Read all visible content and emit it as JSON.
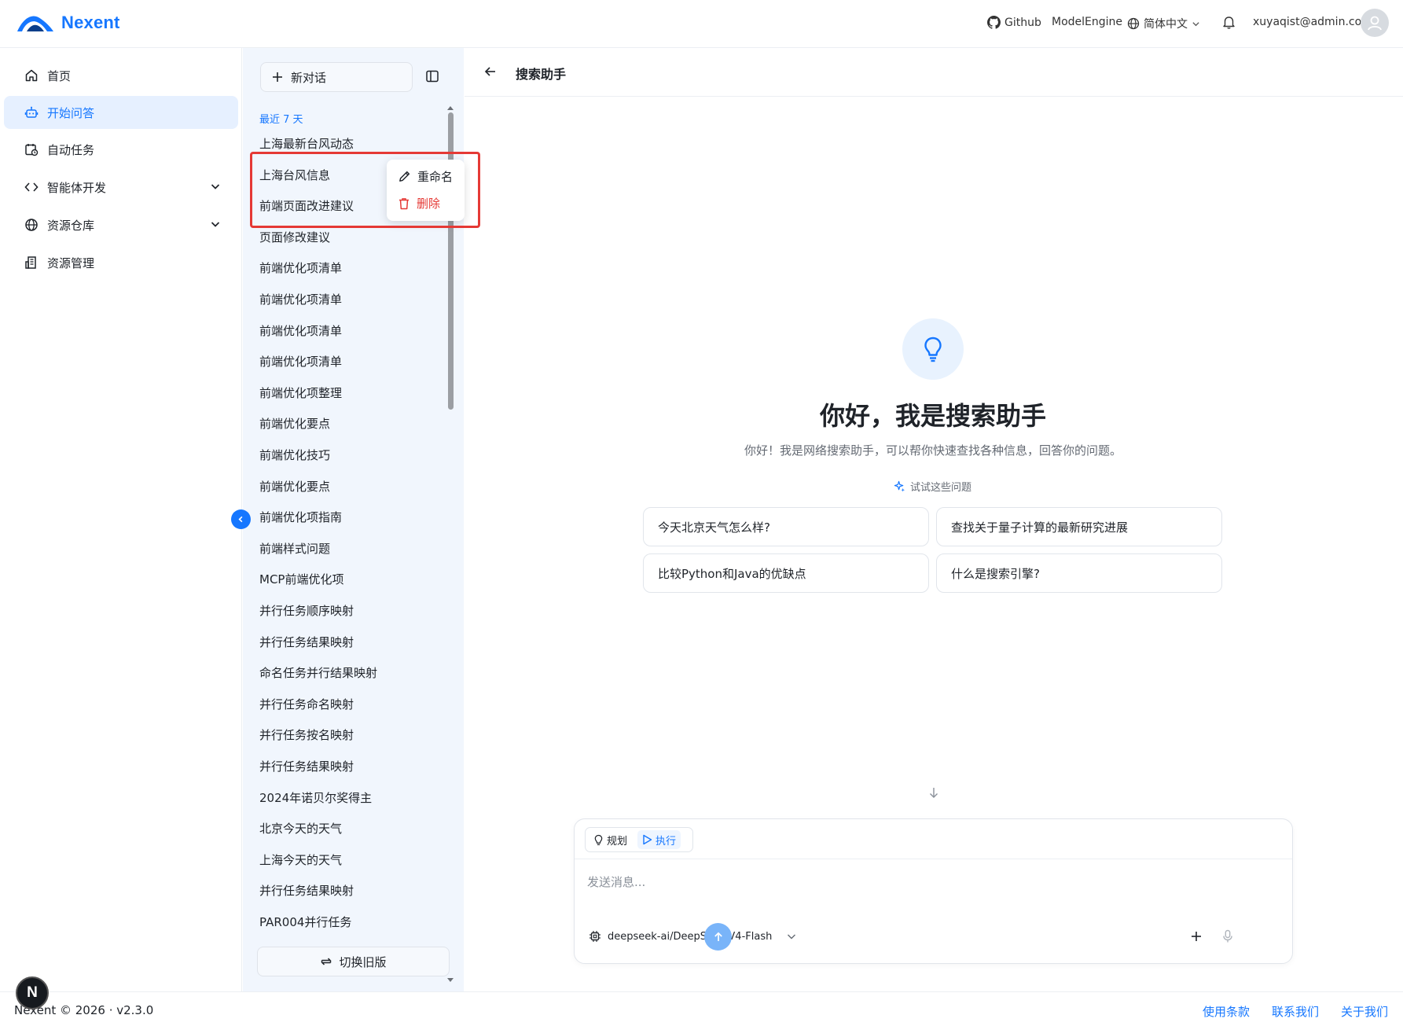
{
  "header": {
    "brand": "Nexent",
    "github": "Github",
    "model_engine": "ModelEngine",
    "language": "简体中文",
    "user_email": "xuyaqist@admin.com"
  },
  "nav": {
    "home": "首页",
    "start_chat": "开始问答",
    "auto_tasks": "自动任务",
    "agent_dev": "智能体开发",
    "resource_repo": "资源仓库",
    "resource_mgmt": "资源管理"
  },
  "chat_list": {
    "new_chat": "新对话",
    "section_label": "最近 7 天",
    "items": [
      "上海最新台风动态",
      "上海台风信息",
      "前端页面改进建议",
      "页面修改建议",
      "前端优化项清单",
      "前端优化项清单",
      "前端优化项清单",
      "前端优化项清单",
      "前端优化项整理",
      "前端优化要点",
      "前端优化技巧",
      "前端优化要点",
      "前端优化项指南",
      "前端样式问题",
      "MCP前端优化项",
      "并行任务顺序映射",
      "并行任务结果映射",
      "命名任务并行结果映射",
      "并行任务命名映射",
      "并行任务按名映射",
      "并行任务结果映射",
      "2024年诺贝尔奖得主",
      "北京今天的天气",
      "上海今天的天气",
      "并行任务结果映射",
      "PAR004并行任务"
    ],
    "switch_old": "切换旧版"
  },
  "context_menu": {
    "rename": "重命名",
    "delete": "删除"
  },
  "main": {
    "agent_name": "搜索助手",
    "greeting": "你好，我是搜索助手",
    "description": "你好！我是网络搜索助手，可以帮你快速查找各种信息，回答你的问题。",
    "try_label": "试试这些问题",
    "suggestions": [
      "今天北京天气怎么样?",
      "查找关于量子计算的最新研究进展",
      "比较Python和Java的优缺点",
      "什么是搜索引擎?"
    ]
  },
  "composer": {
    "mode_plan": "规划",
    "mode_execute": "执行",
    "placeholder": "发送消息...",
    "model": "deepseek-ai/DeepSeek-V4-Flash"
  },
  "footer": {
    "copyright": "Nexent © 2026 · v2.3.0",
    "terms": "使用条款",
    "contact": "联系我们",
    "about": "关于我们"
  },
  "colors": {
    "accent": "#1677ff",
    "danger": "#e53935",
    "chat_bg": "#f1f6fd"
  }
}
